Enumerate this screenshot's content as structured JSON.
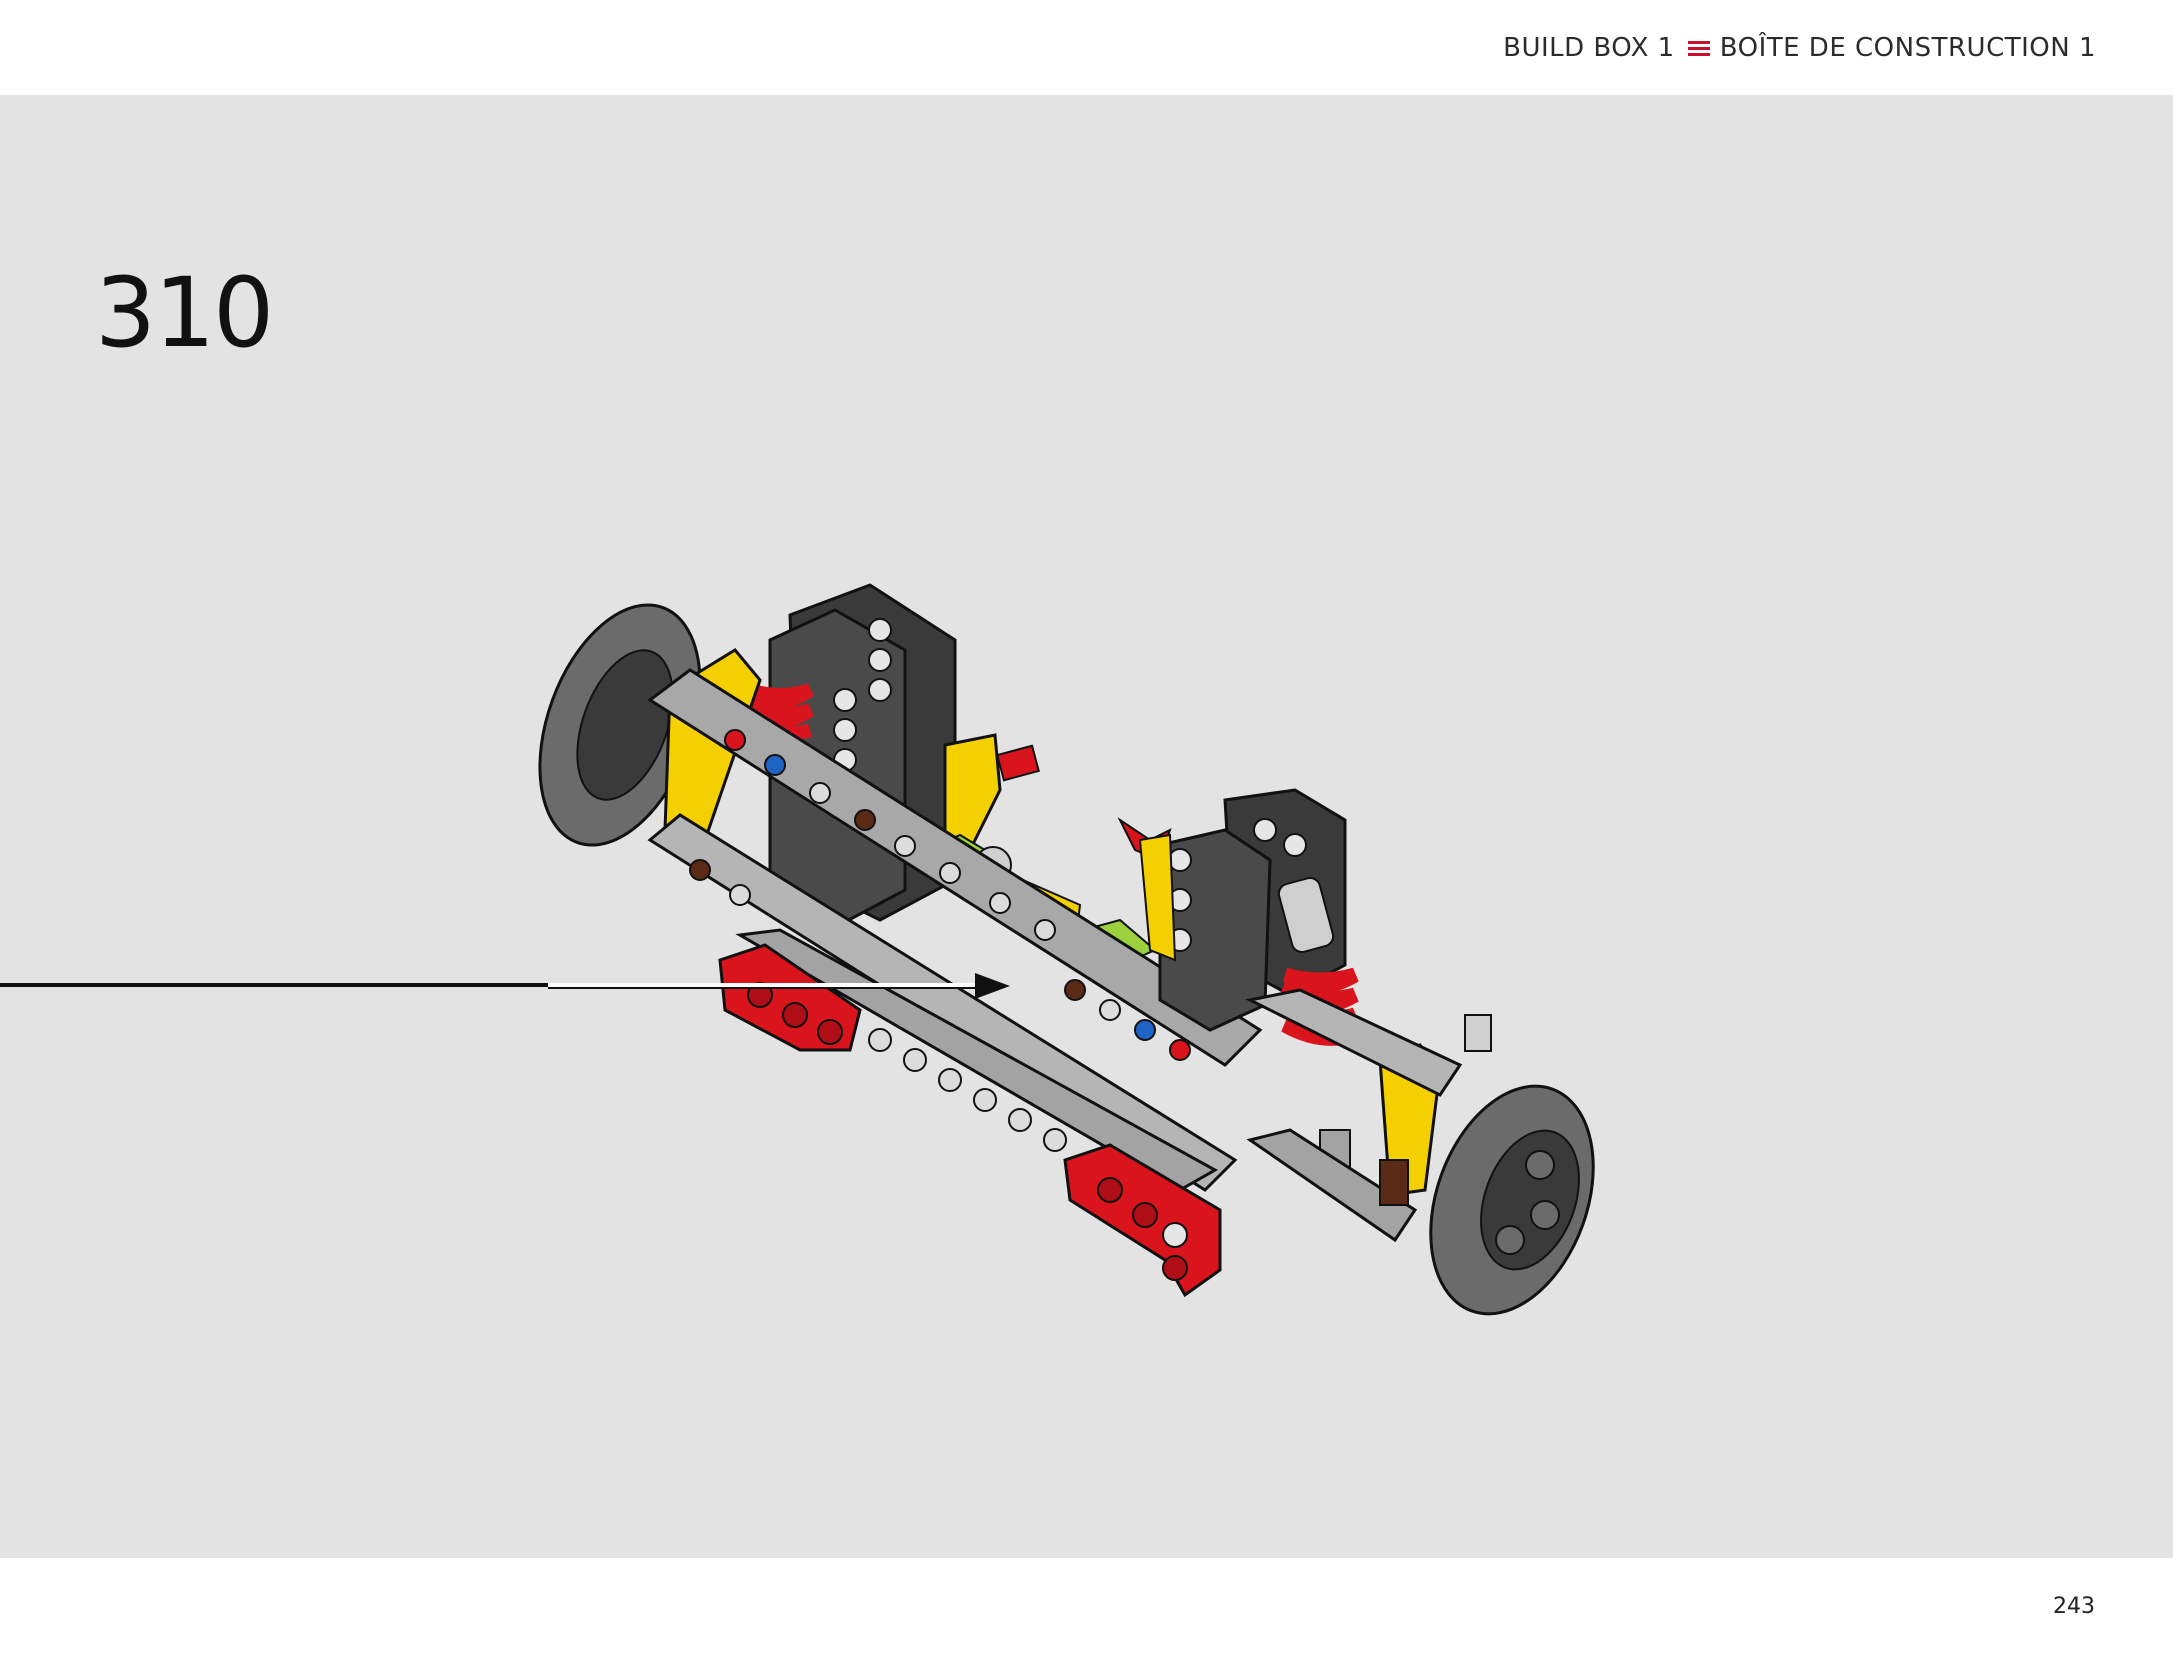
{
  "header": {
    "label_en": "BUILD BOX 1",
    "separator_icon": "triple-line-menu-icon",
    "label_fr": "BOÎTE DE CONSTRUCTION 1",
    "accent_color": "#c8102e"
  },
  "step": {
    "number": "310"
  },
  "illustration": {
    "subject_icon": "technic-suspension-chassis-illustration",
    "pointer_icon": "arrow-right-icon"
  },
  "footer": {
    "page_number": "243"
  },
  "colors": {
    "background": "#e3e3e3",
    "page": "#ffffff",
    "part_red": "#d9141d",
    "part_yellow": "#f5d000",
    "part_gray": "#a3a3a3",
    "part_dark": "#3a3a3a",
    "part_lime": "#9bd13c",
    "part_blue": "#1e63c6",
    "part_brown": "#5a2a17"
  }
}
